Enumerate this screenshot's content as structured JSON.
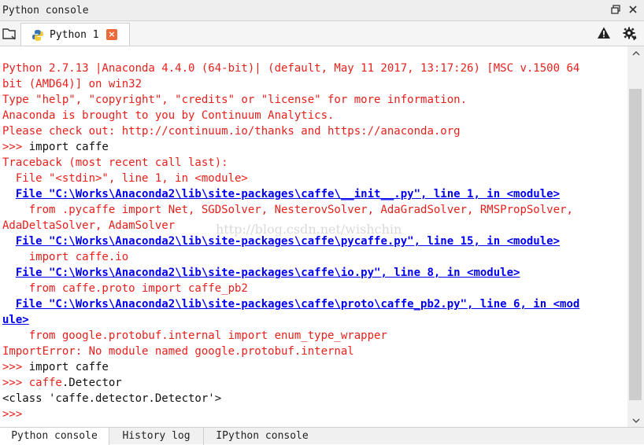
{
  "window": {
    "title": "Python console"
  },
  "tabs": [
    {
      "label": "Python 1",
      "close": "×"
    }
  ],
  "console": {
    "lines": [
      {
        "text": "Python 2.7.13 |Anaconda 4.4.0 (64-bit)| (default, May 11 2017, 13:17:26) [MSC v.1500 64",
        "type": "err"
      },
      {
        "text": "bit (AMD64)] on win32",
        "type": "err"
      },
      {
        "text": "Type \"help\", \"copyright\", \"credits\" or \"license\" for more information.",
        "type": "err"
      },
      {
        "text": "Anaconda is brought to you by Continuum Analytics.",
        "type": "err"
      },
      {
        "text": "Please check out: http://continuum.io/thanks and https://anaconda.org",
        "type": "err"
      },
      {
        "prompt": ">>> ",
        "text": "import caffe",
        "type": "out"
      },
      {
        "text": "Traceback (most recent call last):",
        "type": "err"
      },
      {
        "text": "  File \"<stdin>\", line 1, in <module>",
        "type": "err"
      },
      {
        "indent": "  ",
        "text": "File \"C:\\Works\\Anaconda2\\lib\\site-packages\\caffe\\__init__.py\", line 1, in <module>",
        "type": "link"
      },
      {
        "text": "    from .pycaffe import Net, SGDSolver, NesterovSolver, AdaGradSolver, RMSPropSolver,",
        "type": "err"
      },
      {
        "text": "AdaDeltaSolver, AdamSolver",
        "type": "err"
      },
      {
        "indent": "  ",
        "text": "File \"C:\\Works\\Anaconda2\\lib\\site-packages\\caffe\\pycaffe.py\", line 15, in <module>",
        "type": "link"
      },
      {
        "text": "    import caffe.io",
        "type": "err"
      },
      {
        "indent": "  ",
        "text": "File \"C:\\Works\\Anaconda2\\lib\\site-packages\\caffe\\io.py\", line 8, in <module>",
        "type": "link"
      },
      {
        "text": "    from caffe.proto import caffe_pb2",
        "type": "err"
      },
      {
        "indent": "  ",
        "text": "File \"C:\\Works\\Anaconda2\\lib\\site-packages\\caffe\\proto\\caffe_pb2.py\", line 6, in <mod",
        "type": "link"
      },
      {
        "text": "ule>",
        "type": "link"
      },
      {
        "text": "    from google.protobuf.internal import enum_type_wrapper",
        "type": "err"
      },
      {
        "text": "ImportError: No module named google.protobuf.internal",
        "type": "err"
      },
      {
        "prompt": ">>> ",
        "text": "import caffe",
        "type": "out"
      },
      {
        "prompt": ">>> ",
        "text": "caffe",
        "text2": ".Detector",
        "type": "mixed"
      },
      {
        "text": "<class 'caffe.detector.Detector'>",
        "type": "out"
      },
      {
        "prompt": ">>> ",
        "text": "",
        "type": "out"
      }
    ],
    "watermark": "http://blog.csdn.net/wishchin"
  },
  "bottom_tabs": [
    {
      "label": "Python console"
    },
    {
      "label": "History log"
    },
    {
      "label": "IPython console"
    }
  ],
  "icons": {
    "title_bar": [
      "undock-icon",
      "close-pane-icon"
    ],
    "tab_bar": [
      "new-console-icon",
      "python-icon",
      "warning-icon",
      "gear-icon"
    ]
  },
  "colors": {
    "error": "#e8201c",
    "link": "#0000ee",
    "close": "#ee6a3c"
  }
}
